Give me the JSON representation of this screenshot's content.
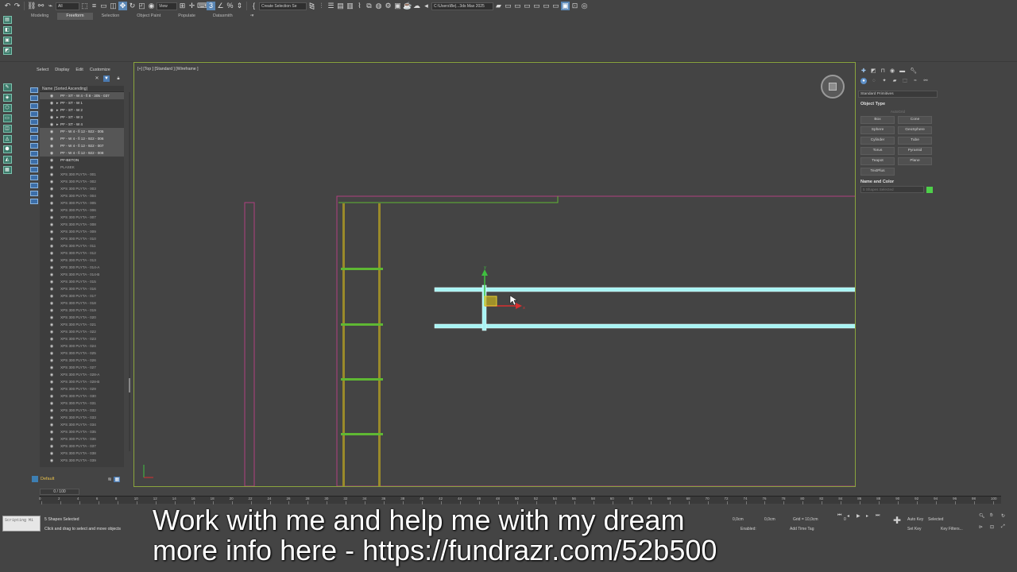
{
  "toolbar": {
    "selection_filter": "All",
    "view_dropdown": "View",
    "named_selection": "Create Selection Se",
    "path": "C:\\Users\\Be|...3ds Max 2025"
  },
  "ribbon": {
    "tabs": [
      {
        "label": "Modeling"
      },
      {
        "label": "Freeform"
      },
      {
        "label": "Selection"
      },
      {
        "label": "Object Paint"
      },
      {
        "label": "Populate"
      },
      {
        "label": "Datasmith"
      }
    ],
    "active_tab": "Freeform"
  },
  "scene_explorer": {
    "menu": [
      "Select",
      "Display",
      "Edit",
      "Customize"
    ],
    "column_header": "Name (Sorted Ascending)",
    "rows": [
      {
        "name": "PF - ST - W 4 - fi 8 - 305 - 037",
        "selected": true,
        "kind": "shape"
      },
      {
        "name": "PF - ST - W 1",
        "selected": false,
        "kind": "group"
      },
      {
        "name": "PF - ST - W 2",
        "selected": false,
        "kind": "group"
      },
      {
        "name": "PF - ST - W 3",
        "selected": false,
        "kind": "group"
      },
      {
        "name": "PF - ST - W 4",
        "selected": false,
        "kind": "group"
      },
      {
        "name": "PF - W 4 - fi 12 - 922 - 005",
        "selected": true,
        "kind": "shape"
      },
      {
        "name": "PF - W 4 - fi 12 - 922 - 006",
        "selected": true,
        "kind": "shape"
      },
      {
        "name": "PF - W 4 - fi 12 - 922 - 007",
        "selected": true,
        "kind": "shape"
      },
      {
        "name": "PF - W 4 - fi 12 - 922 - 008",
        "selected": true,
        "kind": "shape"
      },
      {
        "name": "PF-BETON",
        "selected": false,
        "kind": "shape"
      },
      {
        "name": "PLASEK",
        "selected": false,
        "kind": "object"
      },
      {
        "name": "XPS 300 PLYTA - 001",
        "selected": false,
        "kind": "object"
      },
      {
        "name": "XPS 300 PLYTA - 002",
        "selected": false,
        "kind": "object"
      },
      {
        "name": "XPS 300 PLYTA - 003",
        "selected": false,
        "kind": "object"
      },
      {
        "name": "XPS 300 PLYTA - 004",
        "selected": false,
        "kind": "object"
      },
      {
        "name": "XPS 300 PLYTA - 005",
        "selected": false,
        "kind": "object"
      },
      {
        "name": "XPS 300 PLYTA - 006",
        "selected": false,
        "kind": "object"
      },
      {
        "name": "XPS 300 PLYTA - 007",
        "selected": false,
        "kind": "object"
      },
      {
        "name": "XPS 300 PLYTA - 008",
        "selected": false,
        "kind": "object"
      },
      {
        "name": "XPS 300 PLYTA - 009",
        "selected": false,
        "kind": "object"
      },
      {
        "name": "XPS 300 PLYTA - 010",
        "selected": false,
        "kind": "object"
      },
      {
        "name": "XPS 300 PLYTA - 011",
        "selected": false,
        "kind": "object"
      },
      {
        "name": "XPS 300 PLYTA - 012",
        "selected": false,
        "kind": "object"
      },
      {
        "name": "XPS 300 PLYTA - 013",
        "selected": false,
        "kind": "object"
      },
      {
        "name": "XPS 300 PLYTA - 014-A",
        "selected": false,
        "kind": "object"
      },
      {
        "name": "XPS 300 PLYTA - 014-B",
        "selected": false,
        "kind": "object"
      },
      {
        "name": "XPS 300 PLYTA - 015",
        "selected": false,
        "kind": "object"
      },
      {
        "name": "XPS 300 PLYTA - 016",
        "selected": false,
        "kind": "object"
      },
      {
        "name": "XPS 300 PLYTA - 017",
        "selected": false,
        "kind": "object"
      },
      {
        "name": "XPS 300 PLYTA - 018",
        "selected": false,
        "kind": "object"
      },
      {
        "name": "XPS 300 PLYTA - 019",
        "selected": false,
        "kind": "object"
      },
      {
        "name": "XPS 300 PLYTA - 020",
        "selected": false,
        "kind": "object"
      },
      {
        "name": "XPS 300 PLYTA - 021",
        "selected": false,
        "kind": "object"
      },
      {
        "name": "XPS 300 PLYTA - 022",
        "selected": false,
        "kind": "object"
      },
      {
        "name": "XPS 300 PLYTA - 023",
        "selected": false,
        "kind": "object"
      },
      {
        "name": "XPS 300 PLYTA - 024",
        "selected": false,
        "kind": "object"
      },
      {
        "name": "XPS 300 PLYTA - 025",
        "selected": false,
        "kind": "object"
      },
      {
        "name": "XPS 300 PLYTA - 026",
        "selected": false,
        "kind": "object"
      },
      {
        "name": "XPS 300 PLYTA - 027",
        "selected": false,
        "kind": "object"
      },
      {
        "name": "XPS 300 PLYTA - 028-A",
        "selected": false,
        "kind": "object"
      },
      {
        "name": "XPS 300 PLYTA - 028-B",
        "selected": false,
        "kind": "object"
      },
      {
        "name": "XPS 300 PLYTA - 029",
        "selected": false,
        "kind": "object"
      },
      {
        "name": "XPS 300 PLYTA - 030",
        "selected": false,
        "kind": "object"
      },
      {
        "name": "XPS 300 PLYTA - 031",
        "selected": false,
        "kind": "object"
      },
      {
        "name": "XPS 300 PLYTA - 032",
        "selected": false,
        "kind": "object"
      },
      {
        "name": "XPS 300 PLYTA - 033",
        "selected": false,
        "kind": "object"
      },
      {
        "name": "XPS 300 PLYTA - 034",
        "selected": false,
        "kind": "object"
      },
      {
        "name": "XPS 300 PLYTA - 035",
        "selected": false,
        "kind": "object"
      },
      {
        "name": "XPS 300 PLYTA - 036",
        "selected": false,
        "kind": "object"
      },
      {
        "name": "XPS 300 PLYTA - 037",
        "selected": false,
        "kind": "object"
      },
      {
        "name": "XPS 300 PLYTA - 038",
        "selected": false,
        "kind": "object"
      },
      {
        "name": "XPS 300 PLYTA - 039",
        "selected": false,
        "kind": "object"
      }
    ],
    "layer": "Default"
  },
  "viewport": {
    "label": "[+] [Top ] [Standard ] [Wireframe ]",
    "colors": {
      "border": "#8aa53d",
      "selection": "#a8f4f4",
      "magenta": "#b0407f",
      "olive": "#9a8a2a",
      "green": "#5fb833"
    }
  },
  "command_panel": {
    "category_dropdown": "Standard Primitives",
    "object_type_title": "Object Type",
    "autogrid": "AutoGrid",
    "primitives": [
      "Box",
      "Cone",
      "Sphere",
      "GeoSphere",
      "Cylinder",
      "Tube",
      "Torus",
      "Pyramid",
      "Teapot",
      "Plane",
      "TextPlus"
    ],
    "name_color_title": "Name and Color",
    "name_field": "5 Shapes Selected",
    "swatch_color": "#4ed04a"
  },
  "timeline": {
    "slider": "0 / 100",
    "ticks": [
      "0",
      "2",
      "4",
      "6",
      "8",
      "10",
      "12",
      "14",
      "16",
      "18",
      "20",
      "22",
      "24",
      "26",
      "28",
      "30",
      "32",
      "34",
      "36",
      "38",
      "40",
      "42",
      "44",
      "46",
      "48",
      "50",
      "52",
      "54",
      "56",
      "58",
      "60",
      "62",
      "64",
      "66",
      "68",
      "70",
      "72",
      "74",
      "76",
      "78",
      "80",
      "82",
      "84",
      "86",
      "88",
      "90",
      "92",
      "94",
      "96",
      "98",
      "100"
    ]
  },
  "status": {
    "maxscript": "Scripting Mi",
    "selected": "5 Shapes Selected",
    "prompt": "Click and drag to select and move objects",
    "x": "0,0cm",
    "z": "0,0cm",
    "grid": "Grid = 10,0cm",
    "enabled": "Enabled:",
    "add_time_tag": "Add Time Tag",
    "auto_key": "Auto Key",
    "set_key": "Set Key",
    "selected_dropdown": "Selected",
    "key_filters": "Key Filters...",
    "frame": "0"
  },
  "subtitle": {
    "line1": "Work with me and help me with my dream",
    "line2": "more info here - https://fundrazr.com/52b500"
  }
}
